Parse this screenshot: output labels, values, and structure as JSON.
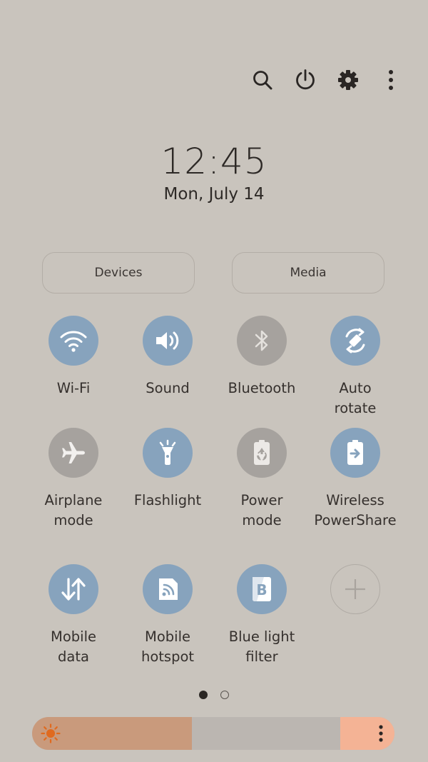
{
  "header": {
    "icons": [
      "search-icon",
      "power-icon",
      "gear-icon",
      "more-vertical-icon"
    ]
  },
  "clock": {
    "time": "12:45",
    "date": "Mon, July 14"
  },
  "buttons": {
    "devices": "Devices",
    "media": "Media"
  },
  "tiles": [
    {
      "label": "Wi-Fi",
      "state": "on",
      "icon": "wifi-icon"
    },
    {
      "label": "Sound",
      "state": "on",
      "icon": "speaker-icon"
    },
    {
      "label": "Bluetooth",
      "state": "off",
      "icon": "bluetooth-icon"
    },
    {
      "label": "Auto\nrotate",
      "state": "on",
      "icon": "rotate-icon"
    },
    {
      "label": "Airplane\nmode",
      "state": "off",
      "icon": "airplane-icon"
    },
    {
      "label": "Flashlight",
      "state": "on",
      "icon": "flashlight-icon"
    },
    {
      "label": "Power\nmode",
      "state": "off",
      "icon": "battery-recycle-icon"
    },
    {
      "label": "Wireless\nPowerShare",
      "state": "on",
      "icon": "wireless-powershare-icon"
    },
    {
      "label": "Mobile\ndata",
      "state": "on",
      "icon": "data-arrows-icon"
    },
    {
      "label": "Mobile\nhotspot",
      "state": "on",
      "icon": "hotspot-icon"
    },
    {
      "label": "Blue light\nfilter",
      "state": "on",
      "icon": "blue-light-filter-icon"
    },
    {
      "label": "",
      "state": "add",
      "icon": "plus-icon"
    }
  ],
  "pager": {
    "pages": 2,
    "current": 1
  },
  "brightness": {
    "level": 0.44,
    "colors": {
      "fill": "#c99a7c",
      "track": "#bbb6b1",
      "end": "#f4b395",
      "sun": "#e06a1f"
    }
  },
  "colors": {
    "background": "#c9c4bd",
    "tile_on": "#87a3bd",
    "tile_off": "#a6a29e"
  }
}
